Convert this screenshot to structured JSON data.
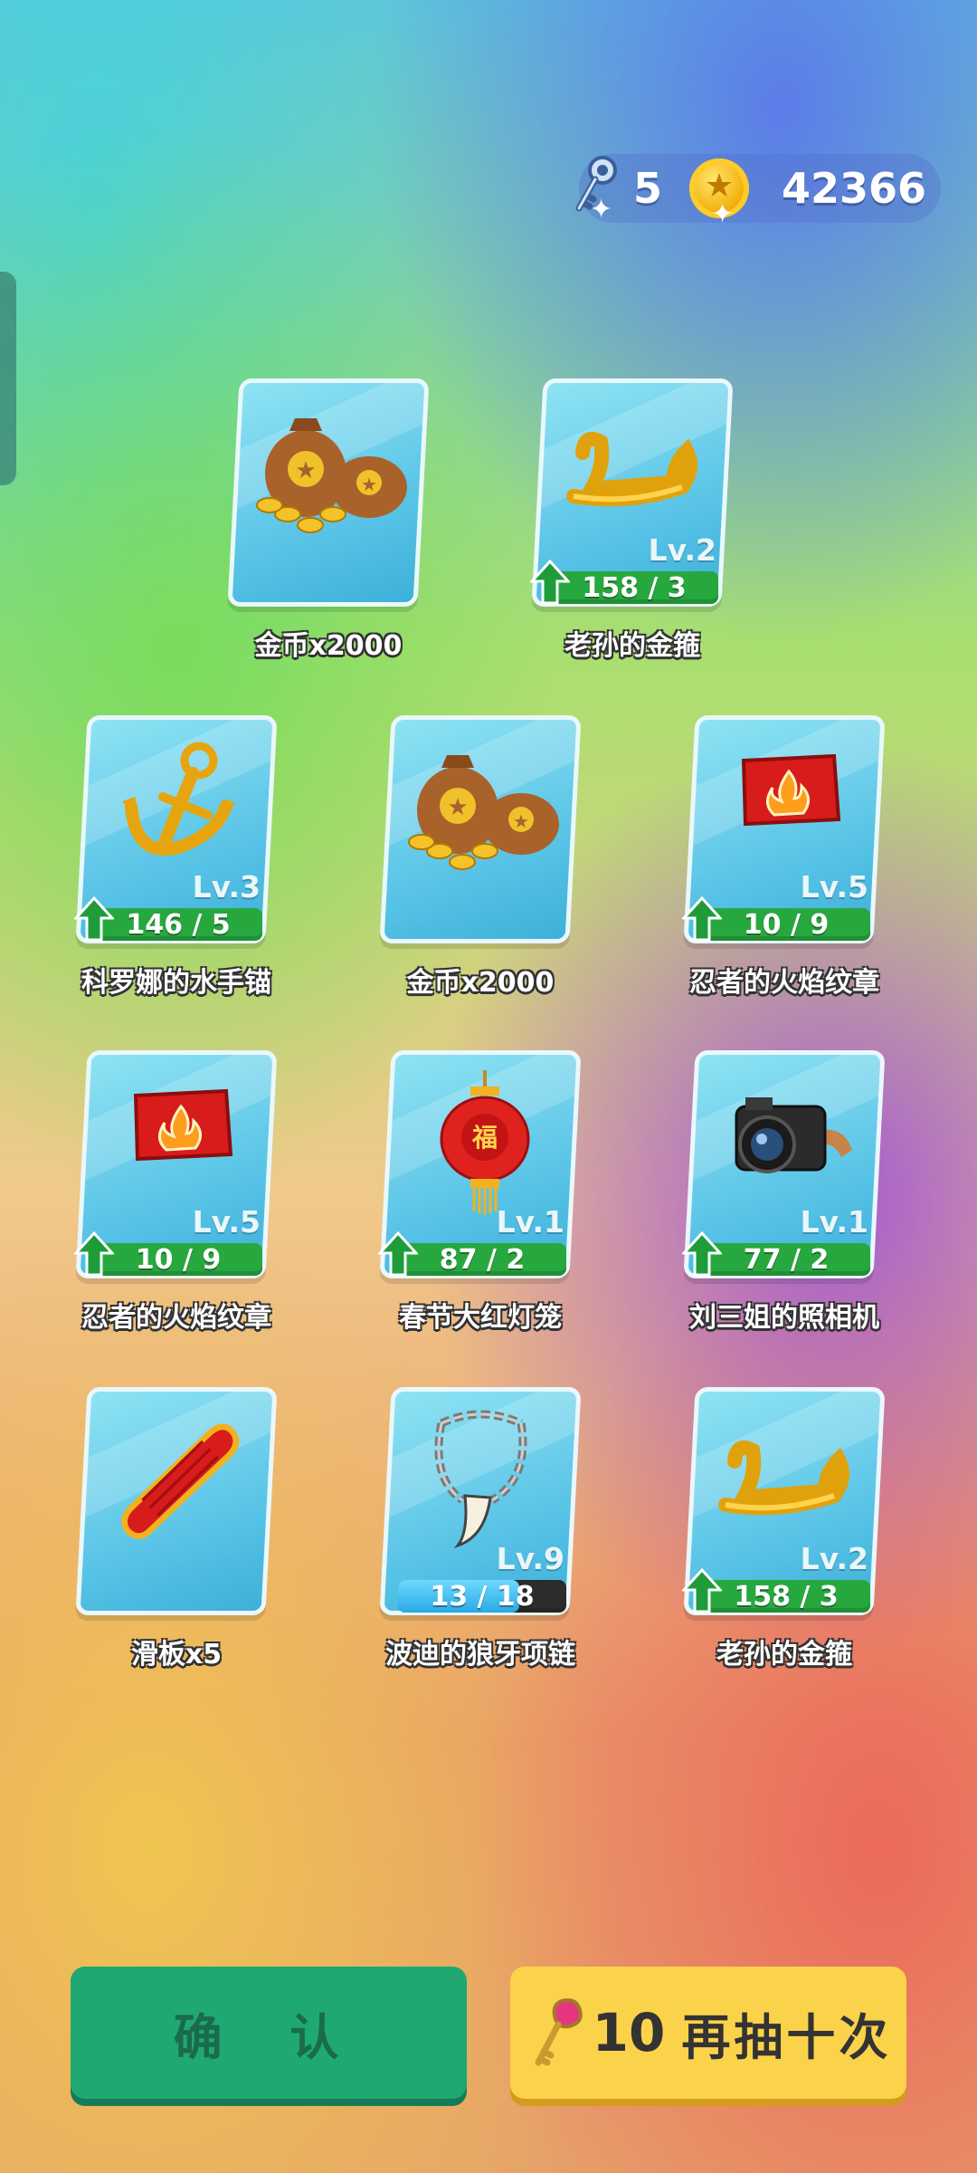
{
  "currency": {
    "keys": "5",
    "coins": "42366",
    "key_icon": "key-icon",
    "coin_icon": "coin-icon"
  },
  "rewards": [
    {
      "name": "金币x2000",
      "icon": "coin-bag-icon",
      "level": null,
      "progress": null
    },
    {
      "name": "老孙的金箍",
      "icon": "golden-headband-icon",
      "level": "Lv.2",
      "progress": "158 / 3",
      "progress_fraction": 1.0,
      "upgradable": true
    },
    {
      "name": "科罗娜的水手锚",
      "icon": "anchor-icon",
      "level": "Lv.3",
      "progress": "146 / 5",
      "progress_fraction": 1.0,
      "upgradable": true
    },
    {
      "name": "金币x2000",
      "icon": "coin-bag-icon",
      "level": null,
      "progress": null
    },
    {
      "name": "忍者的火焰纹章",
      "icon": "fire-emblem-icon",
      "level": "Lv.5",
      "progress": "10 / 9",
      "progress_fraction": 1.0,
      "upgradable": true
    },
    {
      "name": "忍者的火焰纹章",
      "icon": "fire-emblem-icon",
      "level": "Lv.5",
      "progress": "10 / 9",
      "progress_fraction": 1.0,
      "upgradable": true
    },
    {
      "name": "春节大红灯笼",
      "icon": "lantern-icon",
      "level": "Lv.1",
      "progress": "87 / 2",
      "progress_fraction": 1.0,
      "upgradable": true
    },
    {
      "name": "刘三姐的照相机",
      "icon": "camera-icon",
      "level": "Lv.1",
      "progress": "77 / 2",
      "progress_fraction": 1.0,
      "upgradable": true
    },
    {
      "name": "滑板x5",
      "icon": "skateboard-icon",
      "level": null,
      "progress": null
    },
    {
      "name": "波迪的狼牙项链",
      "icon": "fang-necklace-icon",
      "level": "Lv.9",
      "progress": "13 / 18",
      "progress_fraction": 0.72,
      "upgradable": false
    },
    {
      "name": "老孙的金箍",
      "icon": "golden-headband-icon",
      "level": "Lv.2",
      "progress": "158 / 3",
      "progress_fraction": 1.0,
      "upgradable": true
    }
  ],
  "buttons": {
    "confirm": "确 认",
    "again_count": "10",
    "again_label": "再抽十次",
    "again_icon": "pink-key-icon"
  },
  "colors": {
    "progress_green": "#27a83f",
    "progress_blue": "#28a9e6",
    "confirm_bg": "#1fa872",
    "again_bg": "#fbd34a"
  }
}
